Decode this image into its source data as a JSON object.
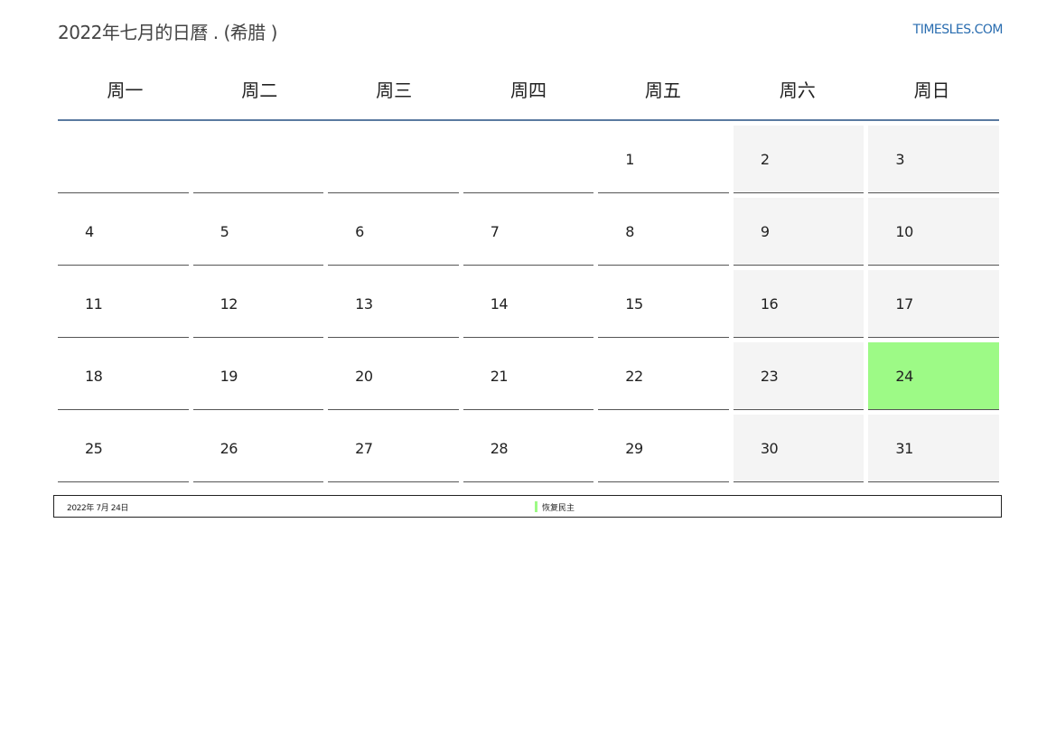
{
  "header": {
    "title": "2022年七月的日曆 . (希腊 )",
    "site": "TIMESLES.COM"
  },
  "weekdays": [
    "周一",
    "周二",
    "周三",
    "周四",
    "周五",
    "周六",
    "周日"
  ],
  "calendar": {
    "cells": [
      {
        "day": "",
        "type": "normal"
      },
      {
        "day": "",
        "type": "normal"
      },
      {
        "day": "",
        "type": "normal"
      },
      {
        "day": "",
        "type": "normal"
      },
      {
        "day": "1",
        "type": "normal"
      },
      {
        "day": "2",
        "type": "weekend"
      },
      {
        "day": "3",
        "type": "weekend"
      },
      {
        "day": "4",
        "type": "normal"
      },
      {
        "day": "5",
        "type": "normal"
      },
      {
        "day": "6",
        "type": "normal"
      },
      {
        "day": "7",
        "type": "normal"
      },
      {
        "day": "8",
        "type": "normal"
      },
      {
        "day": "9",
        "type": "weekend"
      },
      {
        "day": "10",
        "type": "weekend"
      },
      {
        "day": "11",
        "type": "normal"
      },
      {
        "day": "12",
        "type": "normal"
      },
      {
        "day": "13",
        "type": "normal"
      },
      {
        "day": "14",
        "type": "normal"
      },
      {
        "day": "15",
        "type": "normal"
      },
      {
        "day": "16",
        "type": "weekend"
      },
      {
        "day": "17",
        "type": "weekend"
      },
      {
        "day": "18",
        "type": "normal"
      },
      {
        "day": "19",
        "type": "normal"
      },
      {
        "day": "20",
        "type": "normal"
      },
      {
        "day": "21",
        "type": "normal"
      },
      {
        "day": "22",
        "type": "normal"
      },
      {
        "day": "23",
        "type": "weekend"
      },
      {
        "day": "24",
        "type": "holiday"
      },
      {
        "day": "25",
        "type": "normal"
      },
      {
        "day": "26",
        "type": "normal"
      },
      {
        "day": "27",
        "type": "normal"
      },
      {
        "day": "28",
        "type": "normal"
      },
      {
        "day": "29",
        "type": "normal"
      },
      {
        "day": "30",
        "type": "weekend"
      },
      {
        "day": "31",
        "type": "weekend"
      }
    ]
  },
  "holidays": [
    {
      "date": "2022年 7月 24日",
      "name": "恢复民主",
      "color": "#9dfa86"
    }
  ],
  "colors": {
    "weekend_bg": "#f4f4f4",
    "holiday_bg": "#9dfa86",
    "header_rule": "#5a7aa0",
    "link": "#2a6db0"
  }
}
